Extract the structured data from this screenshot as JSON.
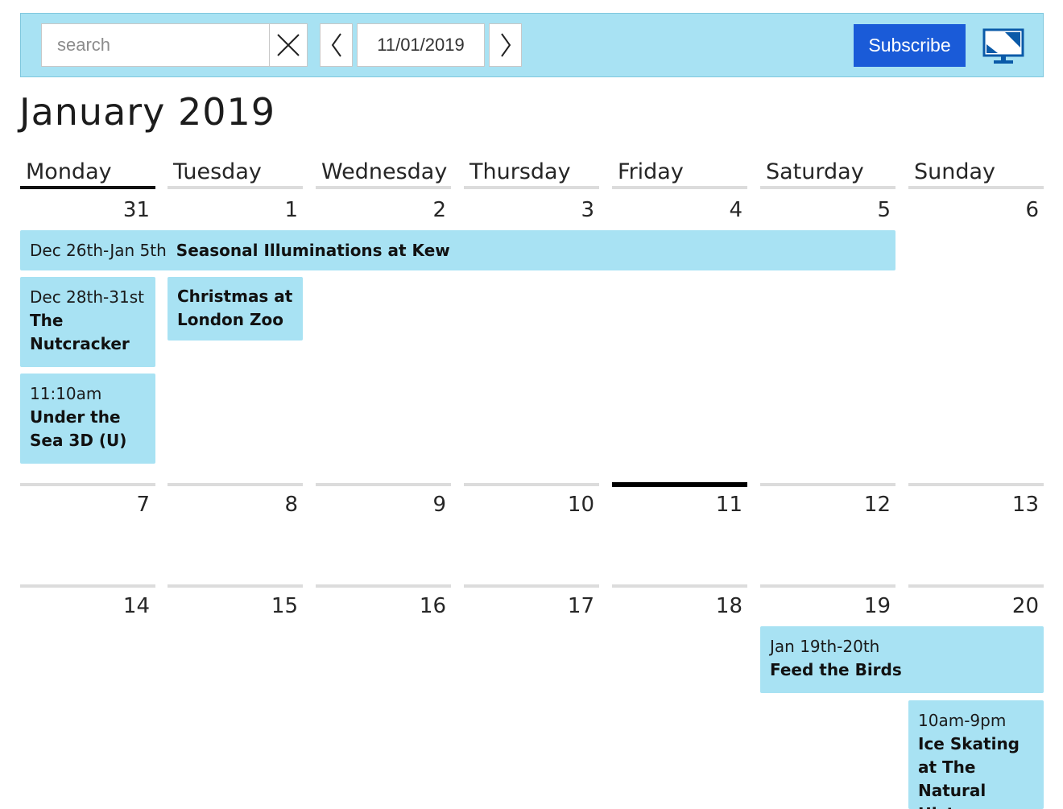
{
  "toolbar": {
    "search_placeholder": "search",
    "date_value": "11/01/2019",
    "subscribe_label": "Subscribe"
  },
  "calendar": {
    "month_title": "January 2019",
    "day_names": [
      "Monday",
      "Tuesday",
      "Wednesday",
      "Thursday",
      "Friday",
      "Saturday",
      "Sunday"
    ],
    "weeks": [
      [
        "31",
        "1",
        "2",
        "3",
        "4",
        "5",
        "6"
      ],
      [
        "7",
        "8",
        "9",
        "10",
        "11",
        "12",
        "13"
      ],
      [
        "14",
        "15",
        "16",
        "17",
        "18",
        "19",
        "20"
      ]
    ]
  },
  "events": [
    {
      "time": "Dec 26th-Jan 5th",
      "title": "Seasonal Illuminations at Kew"
    },
    {
      "time": "Dec 28th-31st",
      "title": "The Nutcracker"
    },
    {
      "time": "",
      "title": "Christmas at London Zoo"
    },
    {
      "time": "11:10am",
      "title": "Under the Sea 3D (U)"
    },
    {
      "time": "Jan 19th-20th",
      "title": "Feed the Birds"
    },
    {
      "time": "10am-9pm",
      "title": "Ice Skating at The Natural History"
    }
  ],
  "colors": {
    "toolbar_bg": "#a8e2f3",
    "event_bg": "#a8e2f3",
    "subscribe_bg": "#1a5bd8",
    "icon_blue": "#0a5aa8"
  }
}
